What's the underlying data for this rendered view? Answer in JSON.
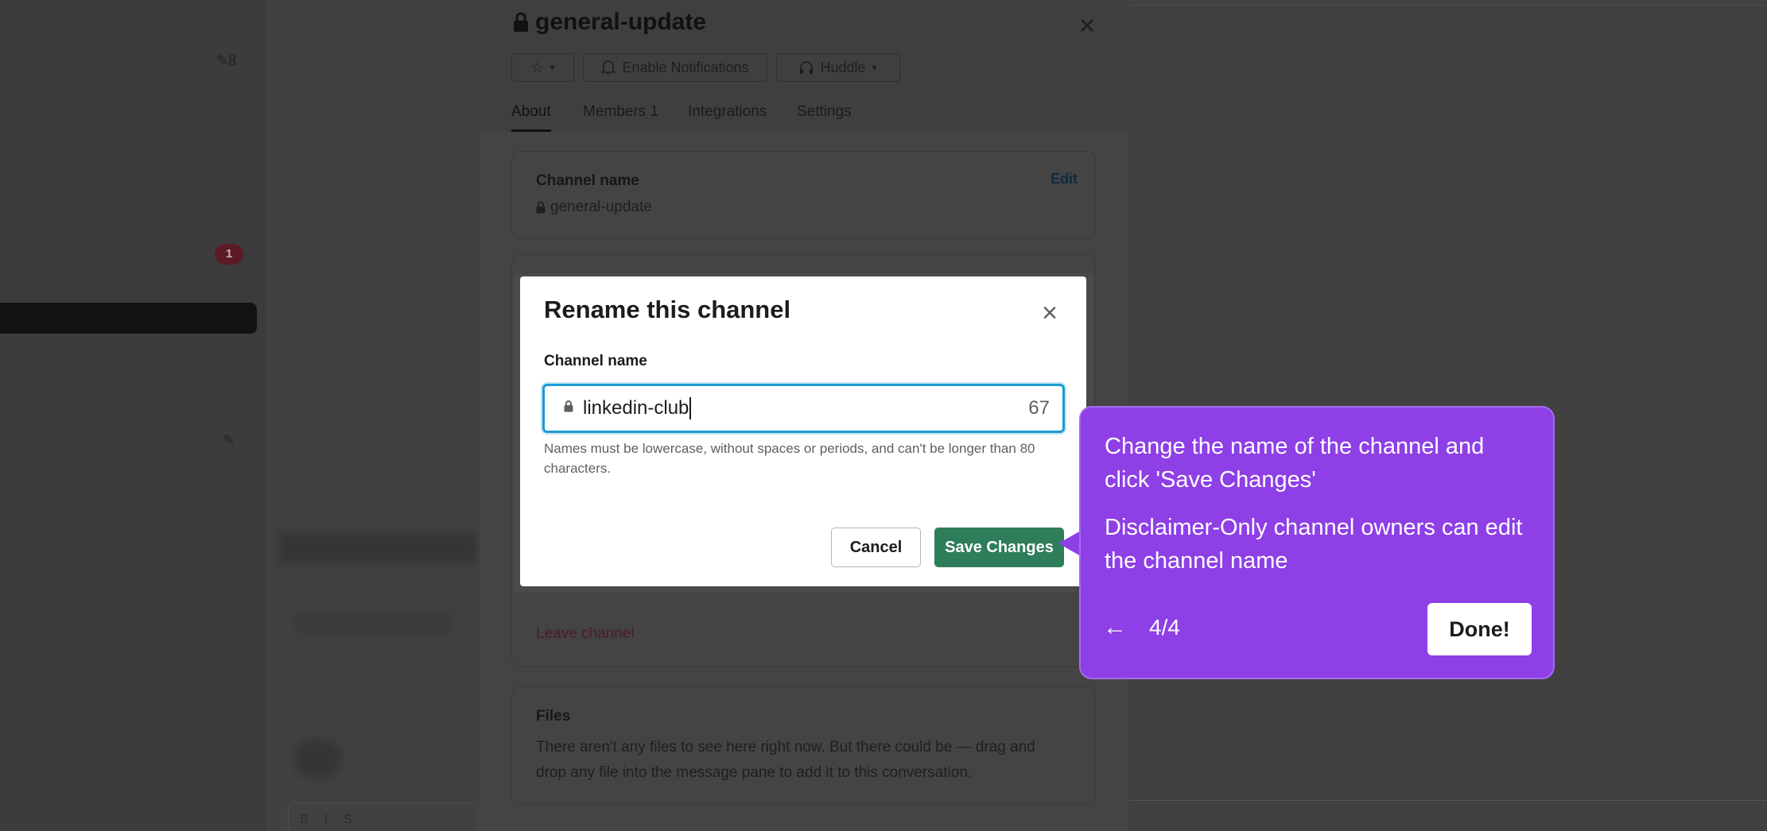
{
  "background": {
    "sidebar_edit_count": "8",
    "unread_badge": "1"
  },
  "channel_panel": {
    "title": "general-update",
    "buttons": {
      "enable_notifications": "Enable Notifications",
      "huddle": "Huddle"
    },
    "tabs": [
      {
        "label": "About"
      },
      {
        "label": "Members 1"
      },
      {
        "label": "Integrations"
      },
      {
        "label": "Settings"
      }
    ],
    "channel_name_card": {
      "label": "Channel name",
      "value": "general-update",
      "edit": "Edit"
    },
    "leave_channel": "Leave channel",
    "files_card": {
      "label": "Files",
      "text": "There aren't any files to see here right now. But there could be — drag and drop any file into the message pane to add it to this conversation."
    }
  },
  "rename_modal": {
    "title": "Rename this channel",
    "field_label": "Channel name",
    "value": "linkedin-club",
    "char_count": "67",
    "help": "Names must be lowercase, without spaces or periods, and can't be longer than 80 characters.",
    "cancel": "Cancel",
    "save": "Save Changes"
  },
  "tour_tooltip": {
    "text1": "Change the name of the channel and click 'Save Changes'",
    "text2": "Disclaimer-Only channel owners can edit the channel name",
    "step": "4/4",
    "done": "Done!"
  },
  "colors": {
    "tooltip": "#8e3fe6",
    "save_button": "#2e7d5b",
    "input_focus": "#1d9bd1"
  }
}
